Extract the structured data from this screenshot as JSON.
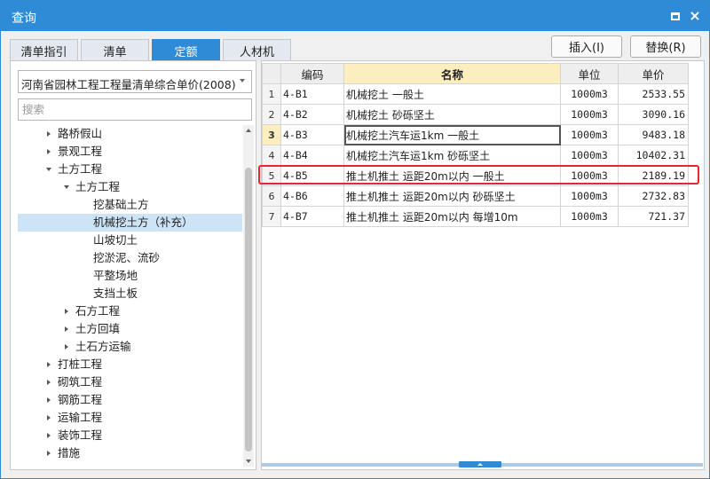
{
  "window": {
    "title": "查询",
    "maximize_icon": "maximize-icon",
    "close_icon": "close-icon",
    "close_glyph": "×"
  },
  "tabs": [
    {
      "label": "清单指引",
      "active": false
    },
    {
      "label": "清单",
      "active": false
    },
    {
      "label": "定额",
      "active": true
    },
    {
      "label": "人材机",
      "active": false
    }
  ],
  "actions": {
    "insert_label": "插入(I)",
    "replace_label": "替换(R)"
  },
  "library": {
    "selected": "河南省园林工程工程量清单综合单价(2008)"
  },
  "search": {
    "placeholder": "搜索",
    "value": ""
  },
  "tree": [
    {
      "label": "路桥假山",
      "level": 1,
      "state": "collapsed"
    },
    {
      "label": "景观工程",
      "level": 1,
      "state": "collapsed"
    },
    {
      "label": "土方工程",
      "level": 1,
      "state": "expanded"
    },
    {
      "label": "土方工程",
      "level": 2,
      "state": "expanded"
    },
    {
      "label": "挖基础土方",
      "level": 3,
      "state": "leaf"
    },
    {
      "label": "机械挖土方（补充）",
      "level": 3,
      "state": "leaf",
      "selected": true
    },
    {
      "label": "山坡切土",
      "level": 3,
      "state": "leaf"
    },
    {
      "label": "挖淤泥、流砂",
      "level": 3,
      "state": "leaf"
    },
    {
      "label": "平整场地",
      "level": 3,
      "state": "leaf"
    },
    {
      "label": "支挡土板",
      "level": 3,
      "state": "leaf"
    },
    {
      "label": "石方工程",
      "level": 2,
      "state": "collapsed"
    },
    {
      "label": "土方回填",
      "level": 2,
      "state": "collapsed"
    },
    {
      "label": "土石方运输",
      "level": 2,
      "state": "collapsed"
    },
    {
      "label": "打桩工程",
      "level": 1,
      "state": "collapsed"
    },
    {
      "label": "砌筑工程",
      "level": 1,
      "state": "collapsed"
    },
    {
      "label": "钢筋工程",
      "level": 1,
      "state": "collapsed"
    },
    {
      "label": "运输工程",
      "level": 1,
      "state": "collapsed"
    },
    {
      "label": "装饰工程",
      "level": 1,
      "state": "collapsed"
    },
    {
      "label": "措施",
      "level": 1,
      "state": "collapsed"
    }
  ],
  "table": {
    "columns": [
      "",
      "编码",
      "名称",
      "单位",
      "单价"
    ],
    "rows": [
      {
        "num": "1",
        "code": "4-B1",
        "name": "机械挖土 一般土",
        "unit": "1000m3",
        "price": "2533.55"
      },
      {
        "num": "2",
        "code": "4-B2",
        "name": "机械挖土 砂砾坚土",
        "unit": "1000m3",
        "price": "3090.16"
      },
      {
        "num": "3",
        "code": "4-B3",
        "name": "机械挖土汽车运1km 一般土",
        "unit": "1000m3",
        "price": "9483.18",
        "current": true
      },
      {
        "num": "4",
        "code": "4-B4",
        "name": "机械挖土汽车运1km 砂砾坚土",
        "unit": "1000m3",
        "price": "10402.31"
      },
      {
        "num": "5",
        "code": "4-B5",
        "name": "推土机推土 运距20m以内 一般土",
        "unit": "1000m3",
        "price": "2189.19",
        "highlighted": true
      },
      {
        "num": "6",
        "code": "4-B6",
        "name": "推土机推土 运距20m以内 砂砾坚土",
        "unit": "1000m3",
        "price": "2732.83"
      },
      {
        "num": "7",
        "code": "4-B7",
        "name": "推土机推土 运距20m以内 每增10m",
        "unit": "1000m3",
        "price": "721.37"
      }
    ]
  },
  "colors": {
    "accent": "#2f8bd6",
    "selection": "#cde4f7",
    "header_highlight": "#fdeebf",
    "highlight_box": "#e8262d"
  }
}
